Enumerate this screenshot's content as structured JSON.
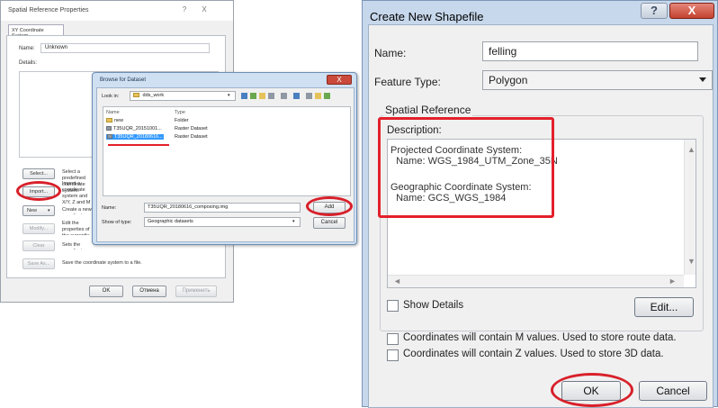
{
  "srp": {
    "title": "Spatial Reference Properties",
    "help_glyph": "?",
    "close_glyph": "X",
    "tab": "XY Coordinate System",
    "name_label": "Name:",
    "name_value": "Unknown",
    "details_label": "Details:",
    "buttons": [
      {
        "label": "Select...",
        "desc": "Select a predefined coordinate system."
      },
      {
        "label": "Import...",
        "desc": "Import a coordinate system and X/Y, Z and M domains from an existing geodataset (e.g., feature dataset, feature class, raster)."
      },
      {
        "label": "New",
        "desc": "Create a new coordinate system."
      },
      {
        "label": "Modify...",
        "desc": "Edit the properties of the currently selected coordinate system."
      },
      {
        "label": "Clear",
        "desc": "Sets the coordinate system to Unknown."
      },
      {
        "label": "Save As...",
        "desc": "Save the coordinate system to a file."
      }
    ],
    "ok": "OK",
    "cancel": "Отмена",
    "apply": "Применить"
  },
  "browse": {
    "title": "Browse for Dataset",
    "close_glyph": "X",
    "look_in_label": "Look in:",
    "look_in_value": "dds_work",
    "columns": [
      "Name",
      "Type"
    ],
    "rows": [
      {
        "name": "new",
        "type": "Folder",
        "icon": "folder-icon"
      },
      {
        "name": "T35UQR_20151001...",
        "type": "Raster Dataset",
        "icon": "raster-icon"
      },
      {
        "name": "T35UQR_20180616...",
        "type": "Raster Dataset",
        "icon": "raster-icon"
      }
    ],
    "name_label": "Name:",
    "name_value": "T35UQR_20180616_composing.img",
    "show_type_label": "Show of type:",
    "show_type_value": "Geographic datasets",
    "add": "Add",
    "cancel": "Cancel"
  },
  "cns": {
    "title": "Create New Shapefile",
    "help_glyph": "?",
    "close_glyph": "X",
    "name_label": "Name:",
    "name_value": "felling",
    "feature_type_label": "Feature Type:",
    "feature_type_value": "Polygon",
    "spatial_ref_label": "Spatial Reference",
    "description_label": "Description:",
    "desc_lines": [
      "Projected Coordinate System:",
      "  Name: WGS_1984_UTM_Zone_35N",
      "",
      "Geographic Coordinate System:",
      "  Name: GCS_WGS_1984"
    ],
    "show_details": "Show Details",
    "edit": "Edit...",
    "m_values": "Coordinates will contain M values. Used to store route data.",
    "z_values": "Coordinates will contain Z values. Used to store 3D data.",
    "ok": "OK",
    "cancel": "Cancel"
  },
  "colors": {
    "highlight_red": "#e3202b",
    "selection_blue": "#3399ff",
    "title_bar_blue": "#c7d8ec"
  }
}
